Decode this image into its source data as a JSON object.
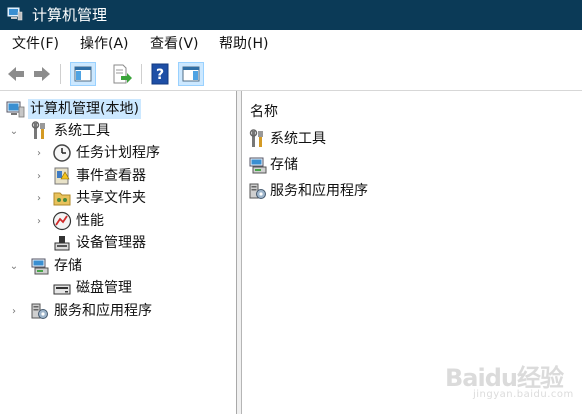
{
  "window": {
    "title": "计算机管理"
  },
  "menu": [
    "文件(F)",
    "操作(A)",
    "查看(V)",
    "帮助(H)"
  ],
  "toolbar": {
    "buttons": [
      "back-arrow-icon",
      "forward-arrow-icon",
      "show-hide-console-tree-icon",
      "export-list-icon",
      "help-icon",
      "show-hide-action-pane-icon"
    ]
  },
  "tree": {
    "root": "计算机管理(本地)",
    "system_tools": "系统工具",
    "task_scheduler": "任务计划程序",
    "event_viewer": "事件查看器",
    "shared_folders": "共享文件夹",
    "performance": "性能",
    "device_manager": "设备管理器",
    "storage": "存储",
    "disk_management": "磁盘管理",
    "services_apps": "服务和应用程序"
  },
  "list": {
    "column_name": "名称",
    "items": [
      "系统工具",
      "存储",
      "服务和应用程序"
    ]
  },
  "watermark": {
    "text": "Baidu经验",
    "sub": "jingyan.baidu.com"
  }
}
